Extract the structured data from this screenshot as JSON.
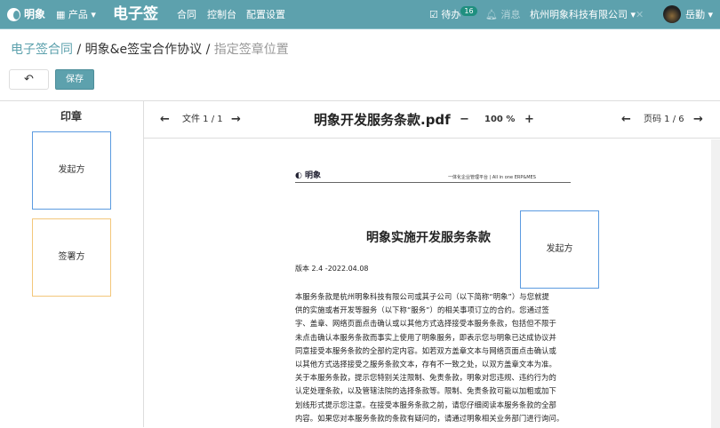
{
  "header": {
    "logo": "明象",
    "products": "产品",
    "app_title": "电子签",
    "nav": [
      "合同",
      "控制台",
      "配置设置"
    ],
    "todo": "待办",
    "todo_count": "16",
    "messages": "消息",
    "company": "杭州明象科技有限公司",
    "user": "岳勤"
  },
  "breadcrumb": {
    "root": "电子签合同",
    "middle": "明象&e签宝合作协议",
    "current": "指定签章位置"
  },
  "toolbar": {
    "back": "↶",
    "save": "保存"
  },
  "left": {
    "title": "印章",
    "stamps": [
      "发起方",
      "签署方"
    ]
  },
  "viewer": {
    "file_label": "文件 1 / 1",
    "filename": "明象开发服务条款.pdf",
    "zoom_minus": "−",
    "zoom": "100 %",
    "zoom_plus": "+",
    "page_label": "页码 1 / 6"
  },
  "doc": {
    "logo": "明象",
    "tagline": "一体化企业管理平台 | All in one ERP&MES",
    "title": "明象实施开发服务条款",
    "version": "版本 2.4 -2022.04.08",
    "placed_stamp": "发起方",
    "lines": [
      "本服务条款是杭州明象科技有限公司或其子公司（以下简称“明象”）与您就提",
      "供的实施或者开发等服务（以下称“服务”）的相关事项订立的合约。您通过签",
      "字、盖章、网络页面点击确认或以其他方式选择接受本服务条款，包括但不限于",
      "未点击确认本服务条款而事实上使用了明象服务，即表示您与明象已达成协议并",
      "同意接受本服务条款的全部约定内容。如若双方盖章文本与网络页面点击确认或",
      "以其他方式选择接受之服务条款文本，存有不一致之处，以双方盖章文本为准。",
      "关于本服务条款，提示您特别关注限制、免责条款，明象对您违规、违约行为的",
      "认定处理条款，以及管辖法院的选择条款等。限制、免责条款可能以加粗或加下",
      "划线形式提示您注意。在接受本服务条款之前，请您仔细阅读本服务条款的全部",
      "内容。如果您对本服务条款的条款有疑问的，请通过明象相关业务部门进行询问。"
    ]
  }
}
